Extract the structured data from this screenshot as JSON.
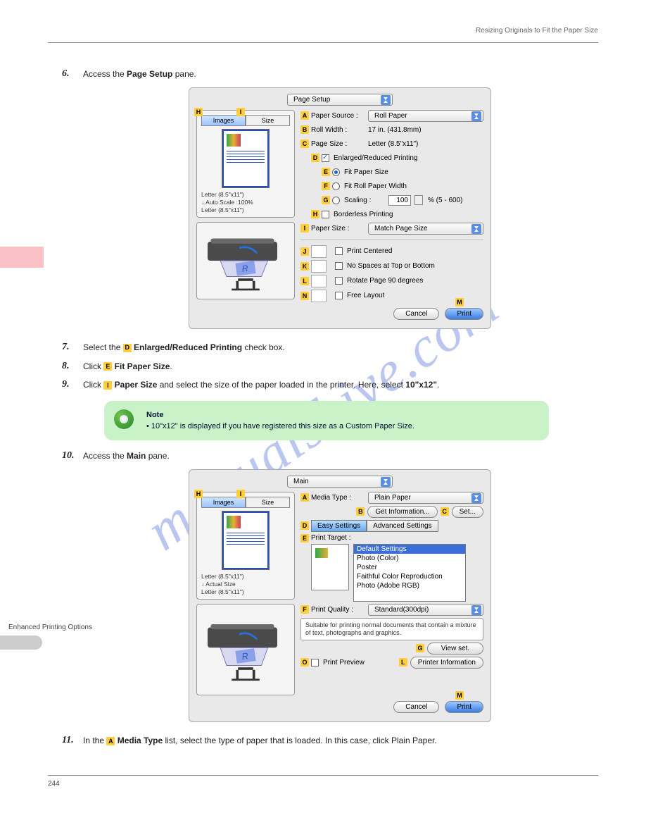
{
  "header": {
    "right": "Resizing Originals to Fit the Paper Size"
  },
  "sidebar": {
    "label": "Enhanced Printing Options"
  },
  "step6": {
    "num": "6.",
    "textPrefix": "Access the ",
    "pane": "Page Setup",
    "textSuffix": " pane."
  },
  "dialog1": {
    "topDropdown": "Page Setup",
    "tabs": {
      "images": "Images",
      "size": "Size"
    },
    "thumbMeta": {
      "l1": "Letter (8.5\"x11\")",
      "l2arrow": "↓",
      "l2": "Auto Scale :100%",
      "l3": "Letter (8.5\"x11\")"
    },
    "letters": {
      "h1": "H",
      "i1": "I"
    },
    "rows": {
      "A": {
        "l": "A",
        "label": "Paper Source :",
        "drop": "Roll Paper"
      },
      "B": {
        "l": "B",
        "label": "Roll Width :",
        "val": "17 in. (431.8mm)"
      },
      "C": {
        "l": "C",
        "label": "Page Size :",
        "val": "Letter (8.5\"x11\")"
      },
      "D": {
        "l": "D",
        "label": "Enlarged/Reduced Printing"
      },
      "E": {
        "l": "E",
        "label": "Fit Paper Size"
      },
      "F": {
        "l": "F",
        "label": "Fit Roll Paper Width"
      },
      "G": {
        "l": "G",
        "label": "Scaling :",
        "val": "100",
        "suffix": "% (5 - 600)"
      },
      "H": {
        "l": "H",
        "label": "Borderless Printing"
      },
      "I": {
        "l": "I",
        "label": "Paper Size :",
        "drop": "Match Page Size"
      },
      "J": {
        "l": "J",
        "label": "Print Centered"
      },
      "K": {
        "l": "K",
        "label": "No Spaces at Top or Bottom"
      },
      "L": {
        "l": "L",
        "label": "Rotate Page 90 degrees"
      },
      "N": {
        "l": "N",
        "label": "Free Layout"
      }
    },
    "buttons": {
      "cancel": "Cancel",
      "print": "Print",
      "m": "M"
    }
  },
  "step7": {
    "num": "7.",
    "t1": "Select the ",
    "d": "D",
    "t2": " Enlarged/Reduced Printing",
    "t3": " check box."
  },
  "step8": {
    "num": "8.",
    "t1": "Click ",
    "e": "E",
    "t2": " Fit Paper Size",
    "t3": "."
  },
  "step9": {
    "num": "9.",
    "t1": "Click ",
    "i": "I",
    "t2": " Paper Size",
    "t3": " and select the size of the paper loaded in the printer. Here, select ",
    "t4": "10\"x12\"",
    "t5": "."
  },
  "note": {
    "title": "Note",
    "bullet": "•  10\"x12\" is displayed if you have registered this size as a Custom Paper Size."
  },
  "step10": {
    "num": "10.",
    "t1": "Access the ",
    "m": "Main",
    "t2": " pane."
  },
  "dialog2": {
    "topDropdown": "Main",
    "tabs": {
      "images": "Images",
      "size": "Size"
    },
    "over": {
      "H": "H",
      "I": "I"
    },
    "thumbMeta": {
      "l1": "Letter (8.5\"x11\")",
      "l2arrow": "↓",
      "l2": "Actual Size",
      "l3": "Letter (8.5\"x11\")"
    },
    "rows": {
      "A": {
        "l": "A",
        "label": "Media Type :",
        "drop": "Plain Paper"
      },
      "B": {
        "l": "B",
        "btn1": "Get Information...",
        "c": "C",
        "btn2": "Set..."
      },
      "D": {
        "l": "D",
        "easy": "Easy Settings",
        "adv": "Advanced Settings"
      },
      "E": {
        "l": "E",
        "label": "Print Target :"
      },
      "list": {
        "i0": "Default Settings",
        "i1": "Photo (Color)",
        "i2": "Poster",
        "i3": "Faithful Color Reproduction",
        "i4": "Photo (Adobe RGB)"
      },
      "F": {
        "l": "F",
        "label": "Print Quality :",
        "drop": "Standard(300dpi)"
      },
      "desc": "Suitable for printing normal documents that contain a mixture of text, photographs and graphics.",
      "G": {
        "l": "G",
        "btn": "View set."
      },
      "O": {
        "l": "O",
        "label": "Print Preview"
      },
      "L": {
        "l": "L",
        "btn": "Printer Information"
      }
    },
    "buttons": {
      "cancel": "Cancel",
      "print": "Print",
      "m": "M"
    }
  },
  "step11": {
    "num": "11.",
    "t1": "In the ",
    "a": "A",
    "t2": " Media Type",
    "t3": " list, select the type of paper that is loaded. In this case, click Plain Paper."
  },
  "footer": {
    "page": "244"
  }
}
